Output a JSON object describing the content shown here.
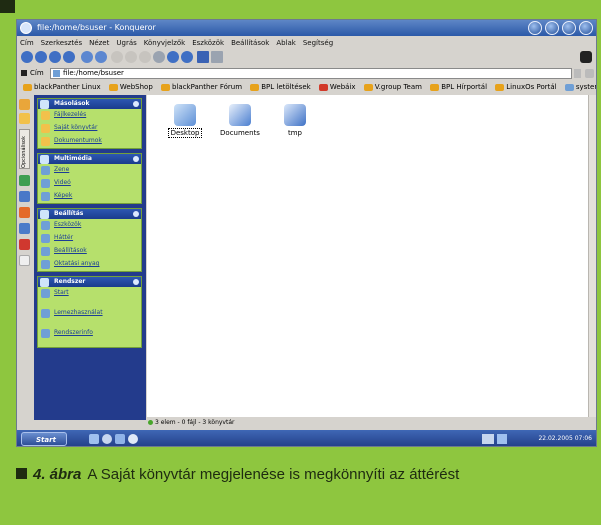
{
  "window": {
    "title": "file:/home/bsuser - Konqueror"
  },
  "menu": [
    "Cím",
    "Szerkesztés",
    "Nézet",
    "Ugrás",
    "Könyvjelzők",
    "Eszközök",
    "Beállítások",
    "Ablak",
    "Segítség"
  ],
  "location": {
    "label": "Cím",
    "value": "file:/home/bsuser"
  },
  "bookmarks": [
    "blackPanther Linux",
    "WebShop",
    "blackPanther Fórum",
    "BPL letöltések",
    "Webáix",
    "V.group Team",
    "BPL Hírportál",
    "LinuxOs Portál",
    "system:/"
  ],
  "sidebar": {
    "vertical_tab": "Opcionálisok",
    "panels": [
      {
        "title": "Másolások",
        "items": [
          "Fájlkezelés",
          "Saját könyvtár",
          "Dokumentumok"
        ]
      },
      {
        "title": "Multimédia",
        "items": [
          "Zene",
          "Videó",
          "Képek"
        ]
      },
      {
        "title": "Beállítás",
        "items": [
          "Eszközök",
          "Háttér",
          "Beállítások",
          "Oktatási anyag"
        ]
      },
      {
        "title": "Rendszer",
        "items": [
          "Start",
          "Lemezhasználat",
          "Rendszerinfo"
        ]
      }
    ]
  },
  "files": [
    "Desktop",
    "Documents",
    "tmp"
  ],
  "status": "3 elem - 0 fájl - 3 könyvtár",
  "taskbar": {
    "start": "Start",
    "clock": "22.02.2005 07:06"
  },
  "caption": {
    "figure": "4. ábra",
    "text": "A Saját könyvtár megjelenése is megkönnyíti az áttérést"
  },
  "colors": {
    "page_bg": "#8ec63f",
    "sidebar_bg": "#233b8c",
    "panel_bg": "#b6e06c",
    "titlebar": "#2b59a8"
  }
}
